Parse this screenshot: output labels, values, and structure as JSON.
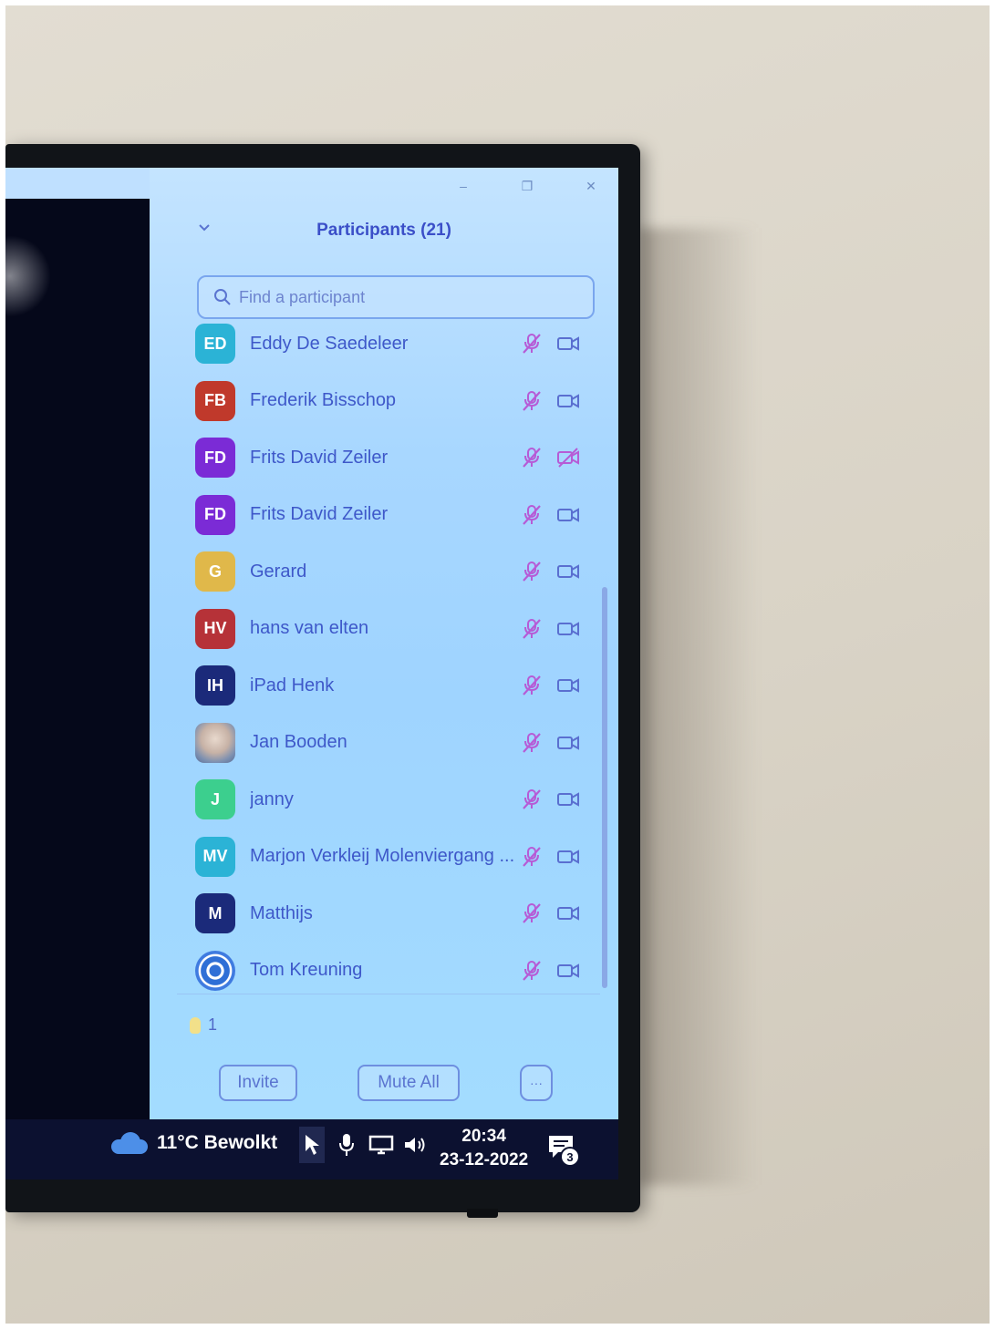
{
  "window": {
    "minimize_glyph": "–",
    "restore_glyph": "❐",
    "close_glyph": "✕"
  },
  "panel": {
    "title": "Participants (21)",
    "search_placeholder": "Find a participant"
  },
  "participants": [
    {
      "initials": "ED",
      "name": "Eddy De Saedeleer",
      "avatar_color": "#2bb3d6",
      "audio": "muted",
      "video": "on"
    },
    {
      "initials": "FB",
      "name": "Frederik Bisschop",
      "avatar_color": "#c0392b",
      "audio": "muted",
      "video": "on"
    },
    {
      "initials": "FD",
      "name": "Frits David Zeiler",
      "avatar_color": "#7b2bd6",
      "audio": "muted",
      "video": "off"
    },
    {
      "initials": "FD",
      "name": "Frits David Zeiler",
      "avatar_color": "#7b2bd6",
      "audio": "muted",
      "video": "on"
    },
    {
      "initials": "G",
      "name": "Gerard",
      "avatar_color": "#e0b84a",
      "audio": "muted",
      "video": "on"
    },
    {
      "initials": "HV",
      "name": "hans van elten",
      "avatar_color": "#b63238",
      "audio": "muted",
      "video": "on"
    },
    {
      "initials": "IH",
      "name": "iPad Henk",
      "avatar_color": "#1b2a7a",
      "audio": "muted",
      "video": "on"
    },
    {
      "initials": "",
      "name": "Jan Booden",
      "avatar_color": "#c7b2a6",
      "audio": "muted",
      "video": "on"
    },
    {
      "initials": "J",
      "name": "janny",
      "avatar_color": "#3ccf8e",
      "audio": "muted",
      "video": "on"
    },
    {
      "initials": "MV",
      "name": "Marjon Verkleij Molenviergang ...",
      "avatar_color": "#2bb3d6",
      "audio": "muted",
      "video": "on"
    },
    {
      "initials": "M",
      "name": "Matthijs",
      "avatar_color": "#1b2a7a",
      "audio": "muted",
      "video": "on"
    },
    {
      "initials": "",
      "name": "Tom Kreuning",
      "avatar_color": "#2f6fd6",
      "audio": "muted",
      "video": "on"
    }
  ],
  "raised_hands": {
    "count": "1"
  },
  "footer": {
    "invite_label": "Invite",
    "mute_all_label": "Mute All",
    "more_label": "···"
  },
  "taskbar": {
    "weather": "11°C Bewolkt",
    "time": "20:34",
    "date": "23-12-2022",
    "notification_count": "3"
  },
  "colors": {
    "accent": "#3b4fc8",
    "muted_icon": "#b65bd6",
    "video_icon": "#5a6fd0",
    "taskbar": "#0c1130"
  }
}
